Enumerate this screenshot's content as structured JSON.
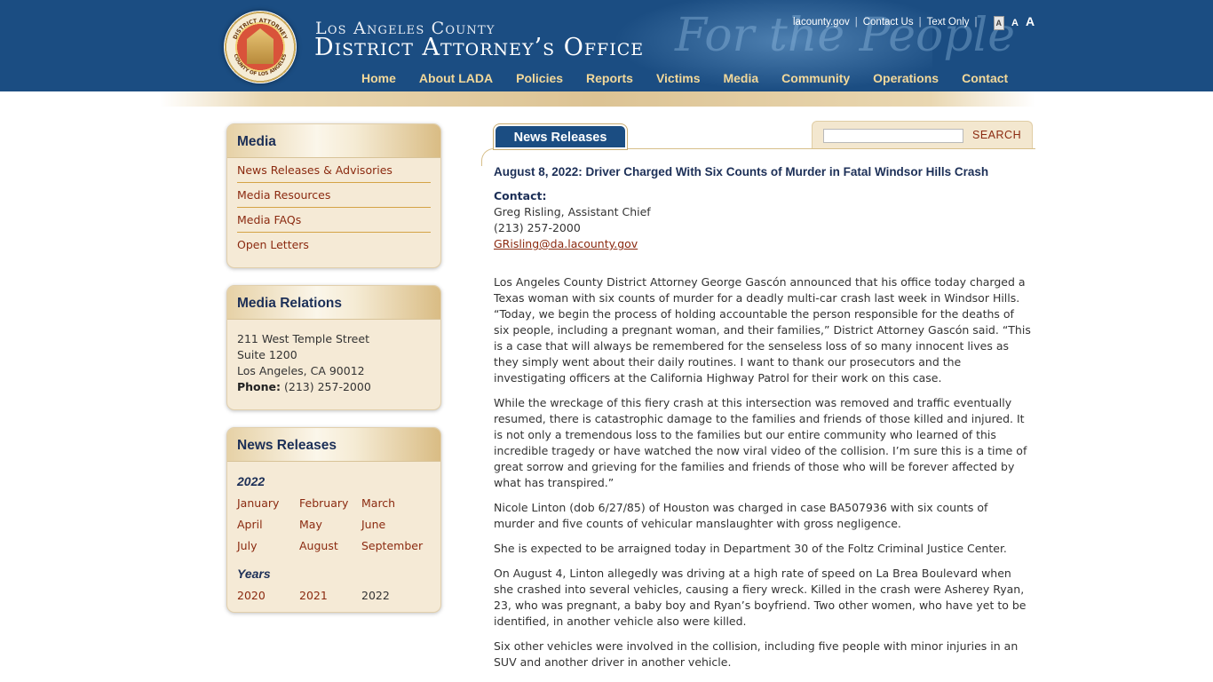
{
  "header": {
    "county": "Los Angeles County",
    "office": "District Attorney’s Office",
    "tagline": "For the People",
    "seal_top_text": "DISTRICT ATTORNEY",
    "seal_bottom_text": "COUNTY OF LOS ANGELES",
    "toplinks": {
      "lacounty": "lacounty.gov",
      "contact": "Contact Us",
      "text_only": "Text Only",
      "sep": "|"
    },
    "font_sizes": [
      "A",
      "A",
      "A"
    ],
    "nav": [
      "Home",
      "About LADA",
      "Policies",
      "Reports",
      "Victims",
      "Media",
      "Community",
      "Operations",
      "Contact"
    ]
  },
  "sidebar": {
    "media": {
      "title": "Media",
      "links": [
        "News Releases & Advisories",
        "Media Resources",
        "Media FAQs",
        "Open Letters"
      ]
    },
    "relations": {
      "title": "Media Relations",
      "address1": "211 West Temple Street",
      "address2": "Suite 1200",
      "address3": "Los Angeles, CA 90012",
      "phone_label": "Phone:",
      "phone": "(213) 257-2000"
    },
    "releases": {
      "title": "News Releases",
      "year": "2022",
      "months": [
        "January",
        "February",
        "March",
        "April",
        "May",
        "June",
        "July",
        "August",
        "September"
      ],
      "years_label": "Years",
      "years": [
        "2020",
        "2021",
        "2022"
      ]
    }
  },
  "main": {
    "tab": "News Releases",
    "search": {
      "placeholder": "",
      "button": "SEARCH"
    },
    "article": {
      "title": "August 8, 2022: Driver Charged With Six Counts of Murder in Fatal Windsor Hills Crash",
      "contact_label": "Contact:",
      "contact_name": "Greg Risling, Assistant Chief",
      "contact_phone": "(213) 257-2000",
      "contact_email": "GRisling@da.lacounty.gov",
      "paragraphs": [
        "Los Angeles County District Attorney George Gascón announced that his office today charged a Texas woman with six counts of murder for a deadly multi-car crash last week in Windsor Hills. “Today, we begin the process of holding accountable the person responsible for the deaths of six people, including a pregnant woman, and their families,” District Attorney Gascón said. “This is a case that will always be remembered for the senseless loss of so many innocent lives as they simply went about their daily routines. I want to thank our prosecutors and the investigating officers at the California Highway Patrol for their work on this case.",
        "While the wreckage of this fiery crash at this intersection was removed and traffic eventually resumed, there is catastrophic damage to the families and friends of those killed and injured. It is not only a tremendous loss to the families but our entire community who learned of this incredible tragedy or have watched the now viral video of the collision. I’m sure this is a time of great sorrow and grieving for the families and friends of those who will be forever affected by what has transpired.”",
        "Nicole Linton (dob 6/27/85) of Houston was charged in case BA507936 with six counts of murder and five counts of vehicular manslaughter with gross negligence.",
        "She is expected to be arraigned today in Department 30 of the Foltz Criminal Justice Center.",
        "On August 4, Linton allegedly was driving at a high rate of speed on La Brea Boulevard when she crashed into several vehicles, causing a fiery wreck. Killed in the crash were Asherey Ryan, 23, who was pregnant, a baby boy and Ryan’s boyfriend. Two other women, who have yet to be identified, in another vehicle also were killed.",
        "Six other vehicles were involved in the collision, including five people with minor injuries in an SUV and another driver in another vehicle."
      ]
    }
  },
  "colors": {
    "header_blue": "#1b4d82",
    "nav_gold": "#f2d89a",
    "link_red": "#8b2a10",
    "heading_navy": "#1c2f57",
    "panel_cream": "#f5ead6"
  }
}
